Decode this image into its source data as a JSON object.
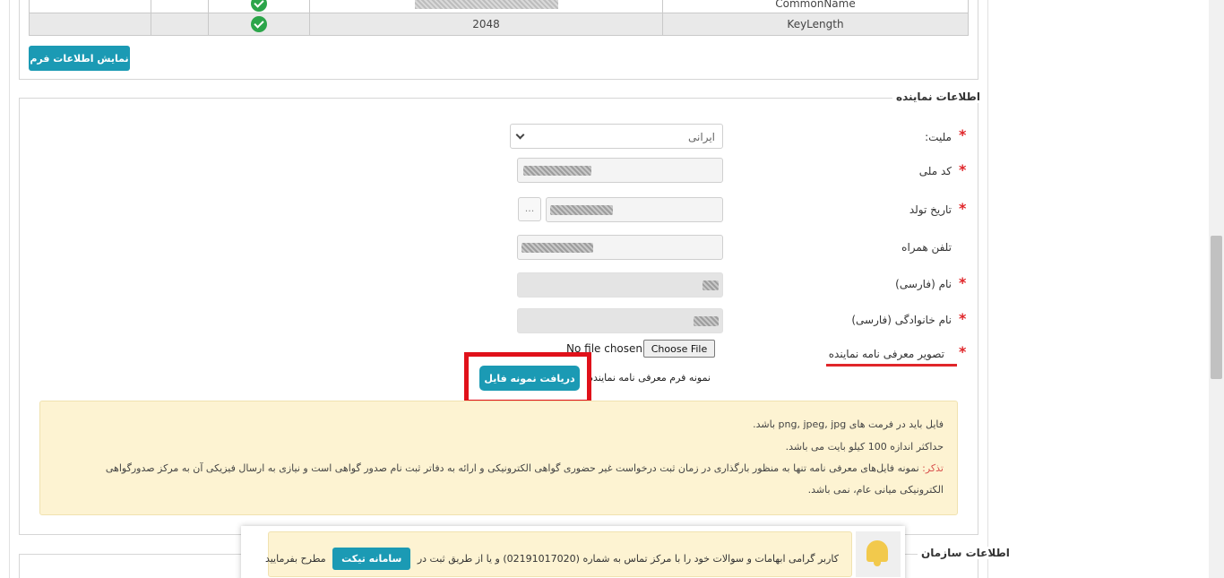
{
  "certificate_table": {
    "rows": [
      {
        "field": "CommonName",
        "value": "",
        "masked": true
      },
      {
        "field": "KeyLength",
        "value": "2048",
        "masked": false
      }
    ]
  },
  "show_form_button": "نمایش اطلاعات فرم",
  "representative_section": {
    "legend": "اطلاعات نماینده",
    "nationality": {
      "label": "ملیت:",
      "value": "ایرانی"
    },
    "national_code": {
      "label": "کد ملی"
    },
    "birth_date": {
      "label": "تاریخ تولد",
      "picker": "..."
    },
    "mobile": {
      "label": "تلفن همراه"
    },
    "first_name": {
      "label": "نام (فارسی)"
    },
    "last_name": {
      "label": "نام خانوادگی (فارسی)"
    },
    "intro_letter": {
      "label": "تصویر معرفی نامه نماینده",
      "file_status": "No file chosen",
      "choose_file": "Choose File"
    },
    "sample_form_label": "نمونه فرم معرفی نامه نماینده",
    "download_sample_button": "دریافت نمونه فایل",
    "required_marker": "*"
  },
  "notice": {
    "line1": "فایل باید در فرمت های png, jpeg, jpg باشد.",
    "line2": "حداکثر اندازه 100 کیلو بایت می باشد.",
    "note_label": "تذکر:",
    "line3": "نمونه فایل‌های معرفی نامه تنها به منظور بارگذاری در زمان ثبت درخواست غیر حضوری گواهی الکترونیکی و ارائه به دفاتر ثبت نام صدور گواهی است و نیازی به ارسال فیزیکی آن به مرکز صدورگواهی",
    "line4": "الکترونیکی میانی عام، نمی باشد."
  },
  "organization_section": {
    "legend": "اطلاعات سازمان"
  },
  "banner": {
    "text_before": "کاربر گرامی ابهامات و سوالات خود را با مرکز تماس به شماره (02191017020) و یا از طریق ثبت در",
    "ticket_button": "سامانه تیکت",
    "text_after": "مطرح بفرمایید"
  }
}
